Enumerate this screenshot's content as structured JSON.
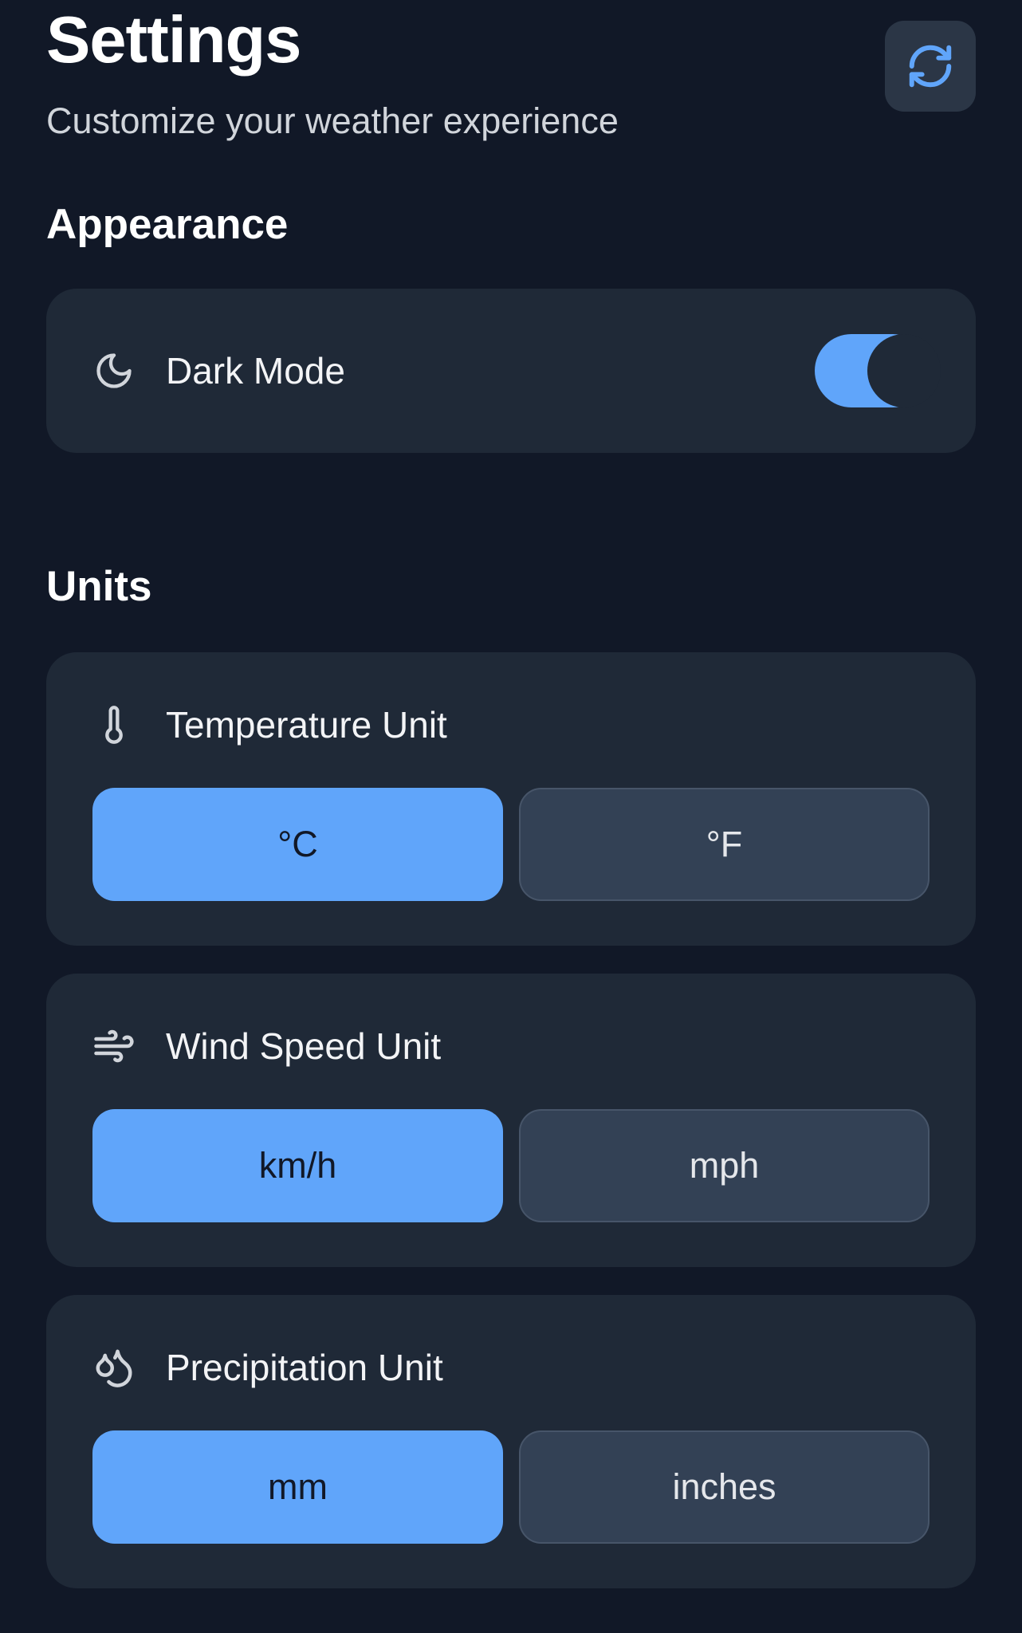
{
  "header": {
    "title": "Settings",
    "subtitle": "Customize your weather experience",
    "refresh_icon": "refresh-icon"
  },
  "appearance": {
    "section_title": "Appearance",
    "dark_mode": {
      "label": "Dark Mode",
      "icon": "moon-icon",
      "enabled": true
    }
  },
  "units": {
    "section_title": "Units",
    "temperature": {
      "label": "Temperature Unit",
      "icon": "thermometer-icon",
      "options": [
        "°C",
        "°F"
      ],
      "selected": "°C"
    },
    "wind_speed": {
      "label": "Wind Speed Unit",
      "icon": "wind-icon",
      "options": [
        "km/h",
        "mph"
      ],
      "selected": "km/h"
    },
    "precipitation": {
      "label": "Precipitation Unit",
      "icon": "droplets-icon",
      "options": [
        "mm",
        "inches"
      ],
      "selected": "mm"
    }
  },
  "colors": {
    "background": "#111827",
    "card": "#1f2937",
    "accent": "#60a5fa",
    "option_unselected": "#334155"
  }
}
